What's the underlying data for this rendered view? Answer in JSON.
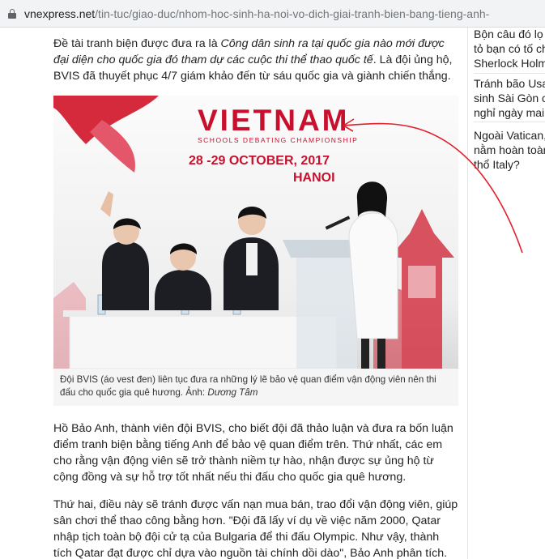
{
  "browser": {
    "url_host": "vnexpress.net",
    "url_path": "/tin-tuc/giao-duc/nhom-hoc-sinh-ha-noi-vo-dich-giai-tranh-bien-bang-tieng-anh-"
  },
  "article": {
    "intro_1": "Đề tài tranh biện được đưa ra là ",
    "intro_topic": "Công dân sinh ra tại quốc gia nào mới được đại diện cho quốc gia đó tham dự các cuộc thi thể thao quốc tế",
    "intro_2": ". Là đội ủng hộ, BVIS đã thuyết phục 4/7 giám khảo đến từ sáu quốc gia và giành chiến thắng.",
    "photo": {
      "banner_title": "VIETNAM",
      "banner_subtitle": "SCHOOLS DEBATING CHAMPIONSHIP",
      "banner_date": "28 -29 OCTOBER, 2017",
      "banner_city": "HANOI"
    },
    "caption_text": "Đội BVIS (áo vest đen) liên tục đưa ra những lý lẽ bảo vệ quan điểm vận động viên nên thi đấu cho quốc gia quê hương. Ảnh: ",
    "caption_author": "Dương Tâm",
    "para_2": "Hồ Bảo Anh, thành viên đội BVIS, cho biết đội đã thảo luận và đưa ra bốn luận điểm tranh biện bằng tiếng Anh để bảo vệ quan điểm trên. Thứ nhất, các em cho rằng vận động viên sẽ trở thành niềm tự hào, nhận được sự ủng hộ từ cộng đồng và sự hỗ trợ tốt nhất nếu thi đấu cho quốc gia quê hương.",
    "para_3": "Thứ hai, điều này sẽ tránh được vấn nạn mua bán, trao đổi vận động viên, giúp sân chơi thể thao công bằng hơn. \"Đội đã lấy ví dụ về việc năm 2000, Qatar nhập tịch toàn bộ đội cử tạ của Bulgaria để thi đấu Olympic. Như vậy, thành tích Qatar đạt được chỉ dựa vào nguồn tài chính dồi dào\", Bảo Anh phân tích."
  },
  "sidebar": {
    "item_1_line_1": "Bộn câu đó lọ",
    "item_1_line_2": "tỏ bạn có tố ch",
    "item_1_line_3": "Sherlock Holm",
    "item_2_line_1": "Tránh bão Usa",
    "item_2_line_2": "sinh Sài Gòn c",
    "item_2_line_3": "nghỉ ngày mai",
    "item_3_line_1": "Ngoài Vatican,",
    "item_3_line_2": "nằm hoàn toàn",
    "item_3_line_3": "thổ Italy?"
  },
  "colors": {
    "brand_red": "#c8102e",
    "annotation_red": "#e0202a"
  }
}
